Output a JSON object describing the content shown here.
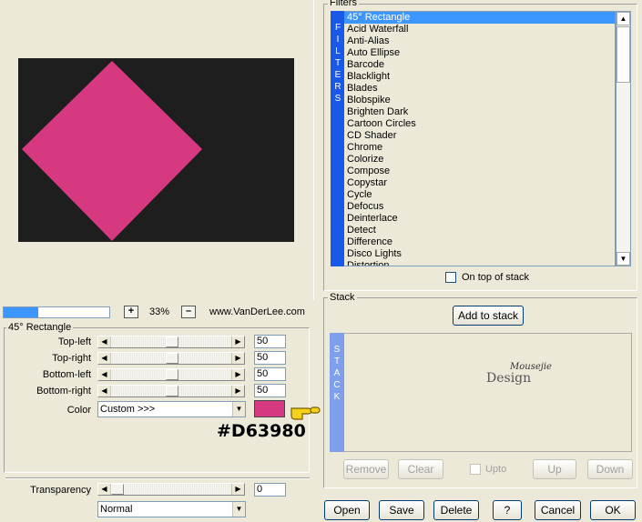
{
  "preview": {
    "background_color": "#1e1e1e",
    "shape_color": "#d63980"
  },
  "progress": {
    "fraction": 0.33
  },
  "zoom": {
    "minus": "–",
    "plus": "+",
    "value": "33%"
  },
  "credit": "www.VanDerLee.com",
  "params": {
    "group_title": "45° Rectangle",
    "sliders": [
      {
        "label": "Top-left",
        "value": "50"
      },
      {
        "label": "Top-right",
        "value": "50"
      },
      {
        "label": "Bottom-left",
        "value": "50"
      },
      {
        "label": "Bottom-right",
        "value": "50"
      }
    ],
    "color_label": "Color",
    "color_select": "Custom >>>",
    "color_swatch": "#d63980",
    "color_hex": "#D63980"
  },
  "transparency": {
    "label": "Transparency",
    "value": "0",
    "blend_mode": "Normal"
  },
  "filters": {
    "group_title": "Filters",
    "tab_letters": [
      "F",
      "I",
      "L",
      "T",
      "E",
      "R",
      "S"
    ],
    "items": [
      "45° Rectangle",
      "Acid Waterfall",
      "Anti-Alias",
      "Auto Ellipse",
      "Barcode",
      "Blacklight",
      "Blades",
      "Blobspike",
      "Brighten Dark",
      "Cartoon Circles",
      "CD Shader",
      "Chrome",
      "Colorize",
      "Compose",
      "Copystar",
      "Cycle",
      "Defocus",
      "Deinterlace",
      "Detect",
      "Difference",
      "Disco Lights",
      "Distortion"
    ],
    "selected_index": 0,
    "on_top_label": "On top of stack"
  },
  "stack": {
    "group_title": "Stack",
    "add_button": "Add to stack",
    "tab_letters": [
      "S",
      "T",
      "A",
      "C",
      "K"
    ],
    "logo_main": "Design",
    "logo_script": "Mousejie",
    "remove_button": "Remove",
    "clear_button": "Clear",
    "upto_label": "Upto",
    "up_button": "Up",
    "down_button": "Down"
  },
  "footer": {
    "open": "Open",
    "save": "Save",
    "delete": "Delete",
    "help": "?",
    "cancel": "Cancel",
    "ok": "OK"
  }
}
